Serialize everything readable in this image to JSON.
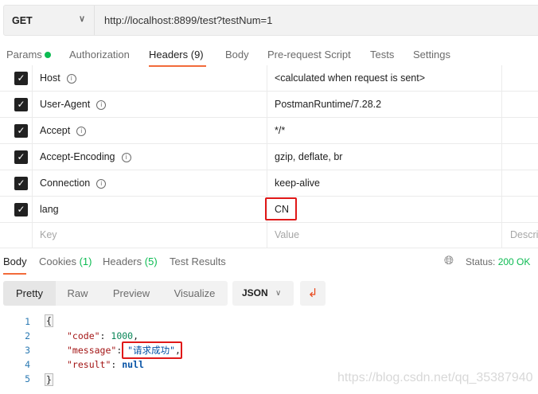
{
  "request": {
    "method": "GET",
    "url": "http://localhost:8899/test?testNum=1"
  },
  "request_tabs": [
    {
      "label": "Params"
    },
    {
      "label": "Authorization"
    },
    {
      "label": "Headers (9)"
    },
    {
      "label": "Body"
    },
    {
      "label": "Pre-request Script"
    },
    {
      "label": "Tests"
    },
    {
      "label": "Settings"
    }
  ],
  "headers": [
    {
      "key": "Host",
      "value": "<calculated when request is sent>",
      "info": true
    },
    {
      "key": "User-Agent",
      "value": "PostmanRuntime/7.28.2",
      "info": true
    },
    {
      "key": "Accept",
      "value": "*/*",
      "info": true
    },
    {
      "key": "Accept-Encoding",
      "value": "gzip, deflate, br",
      "info": true
    },
    {
      "key": "Connection",
      "value": "keep-alive",
      "info": true
    },
    {
      "key": "lang",
      "value": "CN",
      "info": false
    }
  ],
  "new_row": {
    "key_placeholder": "Key",
    "value_placeholder": "Value",
    "desc_placeholder": "Description"
  },
  "response_tabs": {
    "body": "Body",
    "cookies": "Cookies",
    "cookies_count": "(1)",
    "headers": "Headers",
    "headers_count": "(5)",
    "tests": "Test Results"
  },
  "status": {
    "label": "Status:",
    "value": "200 OK"
  },
  "view_modes": [
    "Pretty",
    "Raw",
    "Preview",
    "Visualize"
  ],
  "format": "JSON",
  "code": {
    "line_numbers": [
      "1",
      "2",
      "3",
      "4",
      "5"
    ],
    "open": "{",
    "close": "}",
    "code_key": "\"code\"",
    "code_val": "1000",
    "message_key": "\"message\"",
    "message_val": "\"请求成功\"",
    "result_key": "\"result\"",
    "result_val": "null"
  },
  "watermark": "https://blog.csdn.net/qq_35387940",
  "colors": {
    "accent": "#f26b3a",
    "highlight": "#e01818",
    "success": "#0cbb52"
  }
}
